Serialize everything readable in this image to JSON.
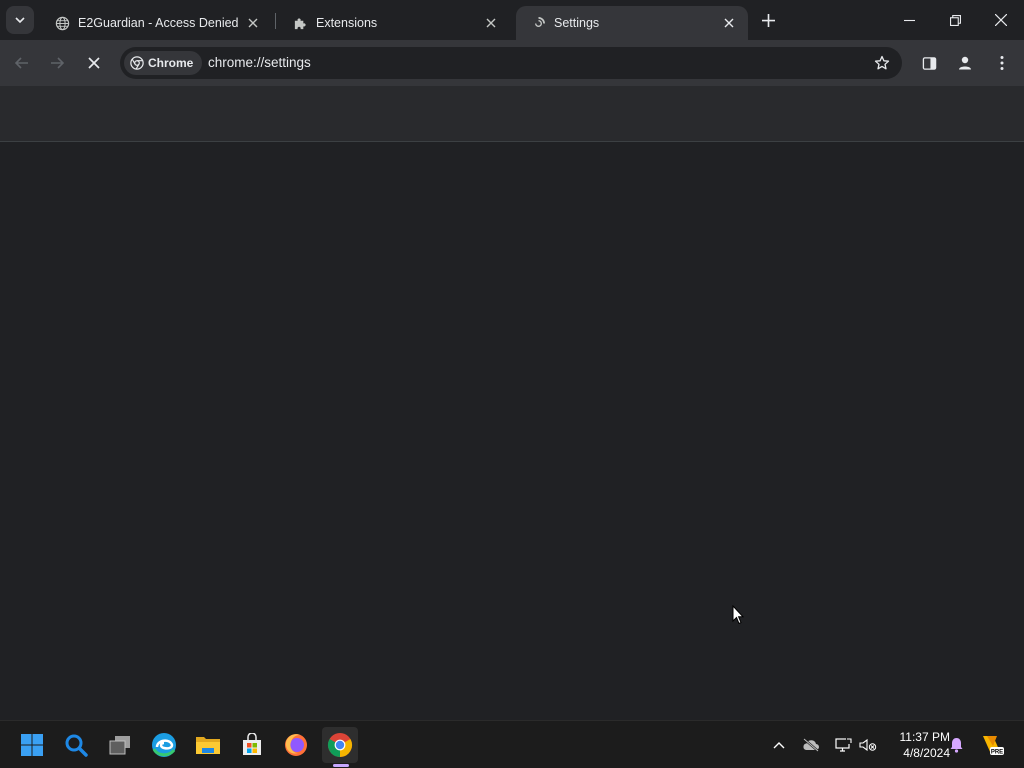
{
  "browser": {
    "tabs": [
      {
        "title": "E2Guardian - Access Denied",
        "favicon": "globe-icon"
      },
      {
        "title": "Extensions",
        "favicon": "puzzle-icon"
      },
      {
        "title": "Settings",
        "favicon": "loading-spinner-icon",
        "active": true
      }
    ],
    "omnibox": {
      "chip_label": "Chrome",
      "url": "chrome://settings"
    }
  },
  "taskbar": {
    "pinned": [
      "windows-start-icon",
      "search-icon",
      "task-view-icon",
      "edge-icon",
      "file-explorer-icon",
      "store-icon",
      "firefox-icon",
      "chrome-icon"
    ],
    "clock": {
      "time": "11:37 PM",
      "date": "4/8/2024"
    }
  },
  "colors": {
    "window_bg": "#202124",
    "toolbar_bg": "#35363a",
    "taskbar_bg": "#1c1c1c"
  }
}
